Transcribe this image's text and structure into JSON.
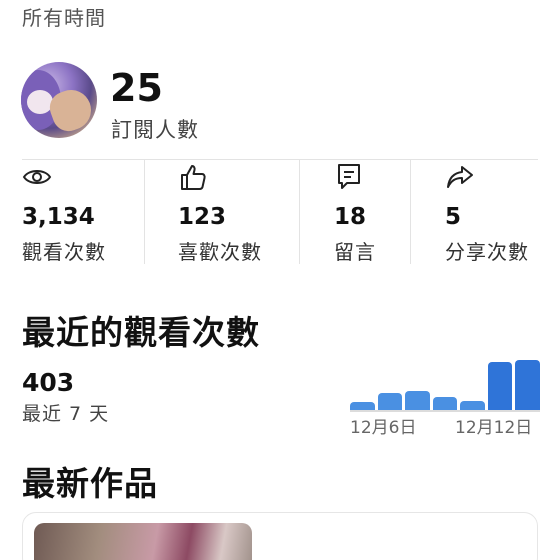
{
  "header": {
    "period": "所有時間"
  },
  "channel": {
    "subscribers": "25",
    "subscribers_label": "訂閱人數"
  },
  "stats": [
    {
      "icon": "eye-icon",
      "value": "3,134",
      "label": "觀看次數"
    },
    {
      "icon": "thumbs-up-icon",
      "value": "123",
      "label": "喜歡次數"
    },
    {
      "icon": "comment-icon",
      "value": "18",
      "label": "留言"
    },
    {
      "icon": "share-icon",
      "value": "5",
      "label": "分享次數"
    }
  ],
  "recent_views": {
    "title": "最近的觀看次數",
    "value": "403",
    "label": "最近 7 天",
    "start_date": "12月6日",
    "end_date": "12月12日",
    "accent": "#4a90e2",
    "chart_data": {
      "type": "bar",
      "categories": [
        "12月6日",
        "12月7日",
        "12月8日",
        "12月9日",
        "12月10日",
        "12月11日",
        "12月12日"
      ],
      "values": [
        16,
        34,
        39,
        27,
        19,
        96,
        100
      ]
    }
  },
  "latest": {
    "title": "最新作品"
  }
}
